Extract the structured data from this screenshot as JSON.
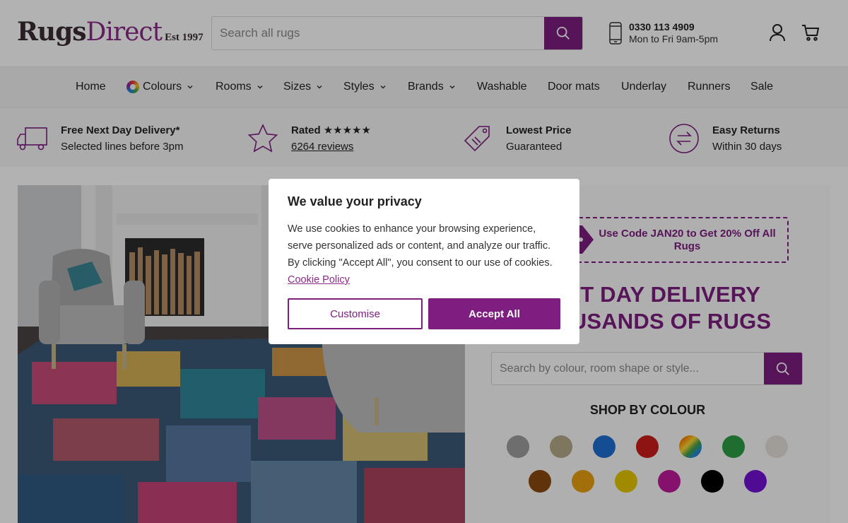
{
  "header": {
    "logo_main_a": "Rugs",
    "logo_main_b": "Direct",
    "logo_est": "Est 1997",
    "search_placeholder": "Search all rugs",
    "phone_number": "0330 113 4909",
    "phone_hours": "Mon to Fri 9am-5pm"
  },
  "nav": {
    "items": [
      {
        "label": "Home"
      },
      {
        "label": "Colours"
      },
      {
        "label": "Rooms"
      },
      {
        "label": "Sizes"
      },
      {
        "label": "Styles"
      },
      {
        "label": "Brands"
      },
      {
        "label": "Washable"
      },
      {
        "label": "Door mats"
      },
      {
        "label": "Underlay"
      },
      {
        "label": "Runners"
      },
      {
        "label": "Sale"
      }
    ]
  },
  "usp": {
    "delivery_title": "Free Next Day Delivery*",
    "delivery_sub": "Selected lines before 3pm",
    "rated_title": "Rated",
    "rated_stars": "★★★★★",
    "rated_reviews": "6264 reviews",
    "price_title": "Lowest Price",
    "price_sub": "Guaranteed",
    "returns_title": "Easy Returns",
    "returns_sub": "Within 30 days"
  },
  "hero": {
    "promo": "Use Code JAN20 to Get 20% Off All Rugs",
    "headline_line1": "NEXT DAY DELIVERY",
    "headline_line2": "THOUSANDS OF RUGS",
    "search_placeholder": "Search by colour, room shape or style...",
    "shop_by_colour": "SHOP BY COLOUR",
    "swatch_colors": [
      "#9e9e9e",
      "#b7a98a",
      "#1e6fd0",
      "#cc1d1d",
      "rainbow",
      "#2d9e45",
      "#e5e0d8",
      "#8a4a10",
      "#e8a00f",
      "#e6c800",
      "#c0199c",
      "#000000",
      "#7310d6"
    ]
  },
  "cookie": {
    "title": "We value your privacy",
    "body": "We use cookies to enhance your browsing experience, serve personalized ads or content, and analyze our traffic. By clicking \"Accept All\", you consent to our use of cookies.",
    "policy_link": "Cookie Policy",
    "customise": "Customise",
    "accept": "Accept All"
  },
  "colors": {
    "brand": "#7d1e80"
  }
}
